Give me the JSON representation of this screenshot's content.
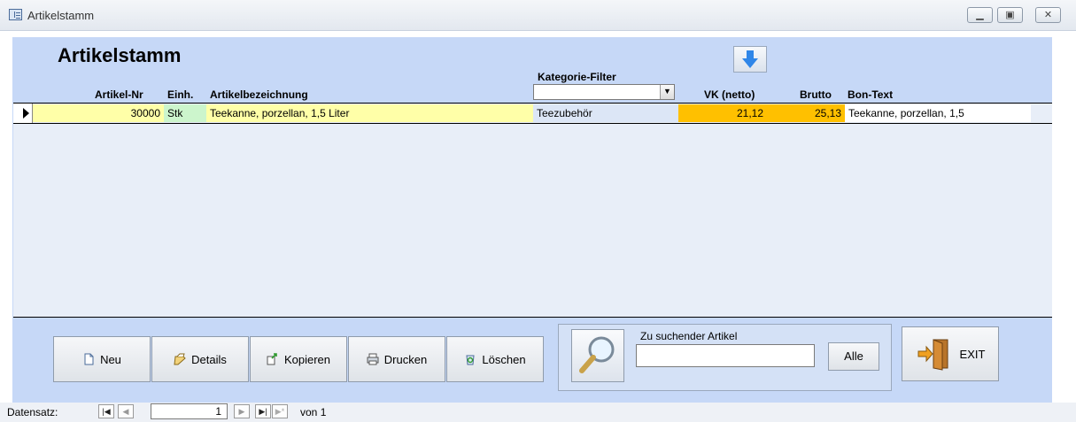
{
  "window": {
    "title": "Artikelstamm",
    "controls": [
      "minimize",
      "restore",
      "close"
    ]
  },
  "form": {
    "heading": "Artikelstamm",
    "kategorie_filter_label": "Kategorie-Filter",
    "kategorie_filter_value": "",
    "columns": {
      "artikel_nr": "Artikel-Nr",
      "einh": "Einh.",
      "bezeichnung": "Artikelbezeichnung",
      "vk_netto": "VK (netto)",
      "brutto": "Brutto",
      "bon_text": "Bon-Text"
    },
    "rows": [
      {
        "artikel_nr": "30000",
        "einh": "Stk",
        "bezeichnung": "Teekanne, porzellan, 1,5 Liter",
        "kategorie": "Teezubehör",
        "vk_netto": "21,12",
        "brutto": "25,13",
        "bon_text": "Teekanne, porzellan, 1,5"
      }
    ]
  },
  "buttons": {
    "neu": "Neu",
    "details": "Details",
    "kopieren": "Kopieren",
    "drucken": "Drucken",
    "loeschen": "Löschen",
    "alle": "Alle",
    "exit": "EXIT"
  },
  "search": {
    "label": "Zu suchender Artikel",
    "value": ""
  },
  "navigation": {
    "label": "Datensatz:",
    "current": "1",
    "of_label": "von",
    "total": "1"
  },
  "colors": {
    "form_bg": "#c6d8f7",
    "yellow_cell": "#ffffa8",
    "green_cell": "#ccf5cc",
    "orange_cell": "#ffc000"
  },
  "icons": {
    "sort": "arrow-down-icon",
    "neu": "new-document-icon",
    "details": "notepad-icon",
    "kopieren": "copy-icon",
    "drucken": "printer-icon",
    "loeschen": "recycle-icon",
    "search": "magnifier-icon",
    "exit": "exit-door-icon"
  }
}
